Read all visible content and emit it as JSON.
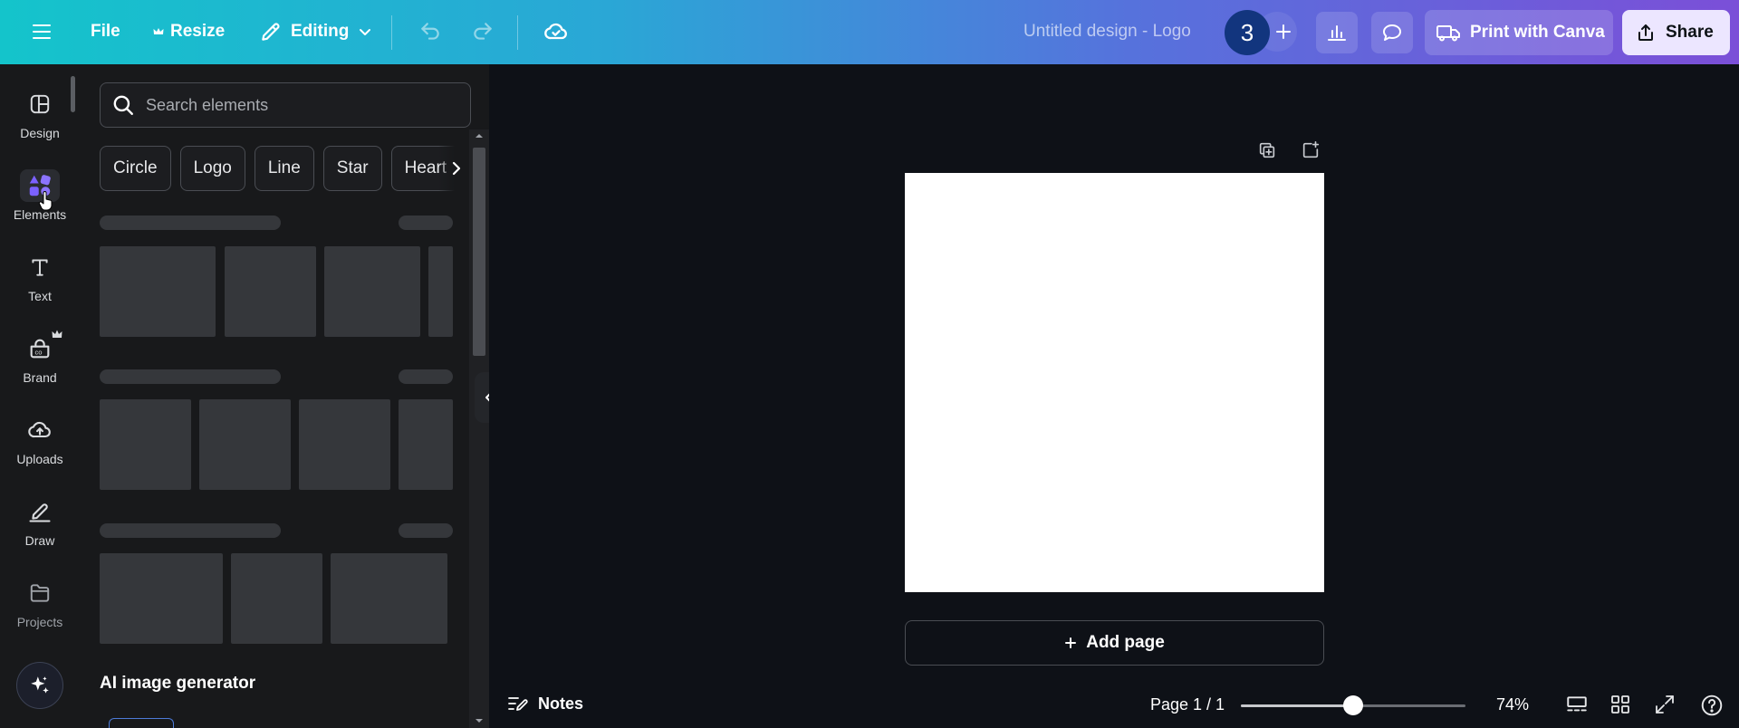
{
  "topbar": {
    "file_label": "File",
    "resize_label": "Resize",
    "editing_label": "Editing",
    "doc_title": "Untitled design - Logo",
    "avatar_initial": "3",
    "print_label": "Print with Canva",
    "share_label": "Share",
    "icons": [
      "menu-icon",
      "crown-icon",
      "pencil-icon",
      "chevron-down-icon",
      "undo-icon",
      "redo-icon",
      "cloud-check-icon",
      "plus-icon",
      "chart-icon",
      "comment-icon",
      "truck-icon",
      "share-icon"
    ]
  },
  "rail": {
    "items": [
      {
        "label": "Design",
        "icon": "design-icon"
      },
      {
        "label": "Elements",
        "icon": "elements-icon"
      },
      {
        "label": "Text",
        "icon": "text-icon"
      },
      {
        "label": "Brand",
        "icon": "brand-icon"
      },
      {
        "label": "Uploads",
        "icon": "uploads-icon"
      },
      {
        "label": "Draw",
        "icon": "draw-icon"
      },
      {
        "label": "Projects",
        "icon": "projects-icon"
      }
    ],
    "active": "Elements",
    "magic_icon": "sparkle-icon"
  },
  "panel": {
    "search_placeholder": "Search elements",
    "chips": [
      "Circle",
      "Logo",
      "Line",
      "Star",
      "Heart"
    ],
    "ai_heading": "AI image generator"
  },
  "canvas": {
    "add_page_label": "Add page",
    "artboard_color": "#ffffff"
  },
  "bottombar": {
    "notes_label": "Notes",
    "page_indicator": "Page 1 / 1",
    "zoom_label": "74%",
    "zoom_fraction": 0.5
  },
  "colors": {
    "gradient_start": "#14c4cb",
    "gradient_end": "#7b4fd8",
    "avatar_bg": "#12357e",
    "share_bg": "#ece6ff",
    "elements_accent": "#7b61ff"
  }
}
